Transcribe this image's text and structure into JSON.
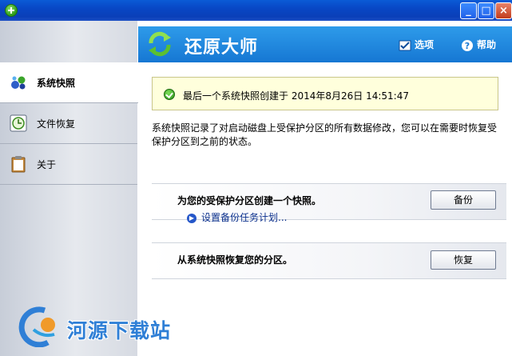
{
  "window": {
    "minimize": "_",
    "maximize": "□",
    "close": "×"
  },
  "sidebar": {
    "items": [
      {
        "label": "系统快照",
        "icon": "snapshot-icon",
        "active": true
      },
      {
        "label": "文件恢复",
        "icon": "clock-icon",
        "active": false
      },
      {
        "label": "关于",
        "icon": "clipboard-icon",
        "active": false
      }
    ]
  },
  "header": {
    "title": "还原大师",
    "options_label": "选项",
    "help_label": "帮助"
  },
  "notice": {
    "text": "最后一个系统快照创建于 2014年8月26日 14:51:47"
  },
  "description": "系统快照记录了对启动磁盘上受保护分区的所有数据修改，您可以在需要时恢复受保护分区到之前的状态。",
  "backup_panel": {
    "text": "为您的受保护分区创建一个快照。",
    "button": "备份",
    "schedule_link": "设置备份任务计划..."
  },
  "restore_panel": {
    "text": "从系统快照恢复您的分区。",
    "button": "恢复"
  },
  "watermark": {
    "text": "河源下载站"
  },
  "colors": {
    "header": "#1a84dc",
    "notice_bg": "#ffffdc",
    "titlebar": "#0a4ac8"
  }
}
